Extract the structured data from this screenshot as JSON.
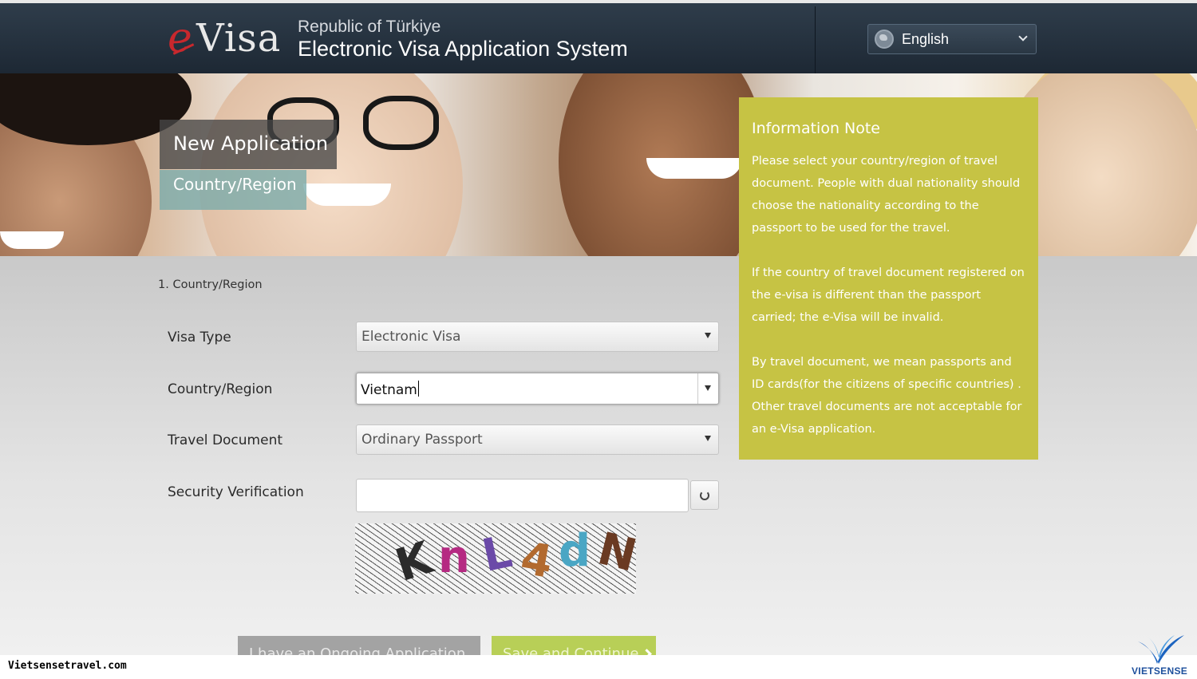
{
  "header": {
    "logo_e": "e",
    "logo_visa": "Visa",
    "subtitle": "Republic of Türkiye",
    "title": "Electronic Visa Application System",
    "language": {
      "selected": "English",
      "icon": "globe-icon"
    }
  },
  "banner": {
    "title": "New Application",
    "subtitle": "Country/Region"
  },
  "info_note": {
    "title": "Information Note",
    "paragraphs": [
      "Please select your country/region of travel document. People with dual nationality should choose the nationality according to the passport to be used for the travel.",
      "If the country of travel document registered on the e-visa is different than the passport carried; the e-Visa will be invalid.",
      "By travel document, we mean passports and ID cards(for the citizens of specific countries) . Other travel documents are not acceptable for an e-Visa application."
    ],
    "background_color": "#c6c344"
  },
  "form": {
    "step": "1. Country/Region",
    "visa_type": {
      "label": "Visa Type",
      "value": "Electronic Visa"
    },
    "country": {
      "label": "Country/Region",
      "value": "Vietnam"
    },
    "travel_document": {
      "label": "Travel Document",
      "value": "Ordinary Passport"
    },
    "security": {
      "label": "Security Verification",
      "value": "",
      "captcha_chars": [
        "K",
        "n",
        "L",
        "4",
        "d",
        "N"
      ]
    }
  },
  "buttons": {
    "ongoing": "I have an Ongoing Application",
    "save": "Save and Continue"
  },
  "watermark": {
    "site": "Vietsensetravel.com",
    "brand": "VIETSENSE"
  },
  "colors": {
    "header": "#1d2834",
    "logo_red": "#c8282d",
    "save_button": "#b8cf57",
    "ongoing_button": "#a3a3a3",
    "brand_blue": "#1d4f9c"
  }
}
